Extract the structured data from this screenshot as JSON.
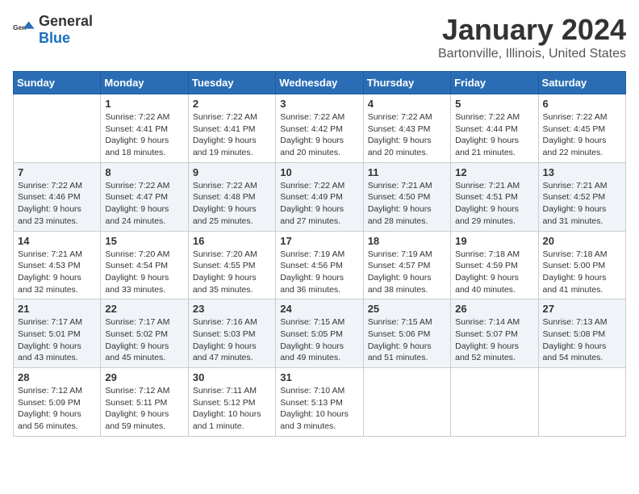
{
  "header": {
    "logo_general": "General",
    "logo_blue": "Blue",
    "month_title": "January 2024",
    "location": "Bartonville, Illinois, United States"
  },
  "days_of_week": [
    "Sunday",
    "Monday",
    "Tuesday",
    "Wednesday",
    "Thursday",
    "Friday",
    "Saturday"
  ],
  "weeks": [
    [
      {
        "day": "",
        "sunrise": "",
        "sunset": "",
        "daylight": ""
      },
      {
        "day": "1",
        "sunrise": "Sunrise: 7:22 AM",
        "sunset": "Sunset: 4:41 PM",
        "daylight": "Daylight: 9 hours and 18 minutes."
      },
      {
        "day": "2",
        "sunrise": "Sunrise: 7:22 AM",
        "sunset": "Sunset: 4:41 PM",
        "daylight": "Daylight: 9 hours and 19 minutes."
      },
      {
        "day": "3",
        "sunrise": "Sunrise: 7:22 AM",
        "sunset": "Sunset: 4:42 PM",
        "daylight": "Daylight: 9 hours and 20 minutes."
      },
      {
        "day": "4",
        "sunrise": "Sunrise: 7:22 AM",
        "sunset": "Sunset: 4:43 PM",
        "daylight": "Daylight: 9 hours and 20 minutes."
      },
      {
        "day": "5",
        "sunrise": "Sunrise: 7:22 AM",
        "sunset": "Sunset: 4:44 PM",
        "daylight": "Daylight: 9 hours and 21 minutes."
      },
      {
        "day": "6",
        "sunrise": "Sunrise: 7:22 AM",
        "sunset": "Sunset: 4:45 PM",
        "daylight": "Daylight: 9 hours and 22 minutes."
      }
    ],
    [
      {
        "day": "7",
        "sunrise": "Sunrise: 7:22 AM",
        "sunset": "Sunset: 4:46 PM",
        "daylight": "Daylight: 9 hours and 23 minutes."
      },
      {
        "day": "8",
        "sunrise": "Sunrise: 7:22 AM",
        "sunset": "Sunset: 4:47 PM",
        "daylight": "Daylight: 9 hours and 24 minutes."
      },
      {
        "day": "9",
        "sunrise": "Sunrise: 7:22 AM",
        "sunset": "Sunset: 4:48 PM",
        "daylight": "Daylight: 9 hours and 25 minutes."
      },
      {
        "day": "10",
        "sunrise": "Sunrise: 7:22 AM",
        "sunset": "Sunset: 4:49 PM",
        "daylight": "Daylight: 9 hours and 27 minutes."
      },
      {
        "day": "11",
        "sunrise": "Sunrise: 7:21 AM",
        "sunset": "Sunset: 4:50 PM",
        "daylight": "Daylight: 9 hours and 28 minutes."
      },
      {
        "day": "12",
        "sunrise": "Sunrise: 7:21 AM",
        "sunset": "Sunset: 4:51 PM",
        "daylight": "Daylight: 9 hours and 29 minutes."
      },
      {
        "day": "13",
        "sunrise": "Sunrise: 7:21 AM",
        "sunset": "Sunset: 4:52 PM",
        "daylight": "Daylight: 9 hours and 31 minutes."
      }
    ],
    [
      {
        "day": "14",
        "sunrise": "Sunrise: 7:21 AM",
        "sunset": "Sunset: 4:53 PM",
        "daylight": "Daylight: 9 hours and 32 minutes."
      },
      {
        "day": "15",
        "sunrise": "Sunrise: 7:20 AM",
        "sunset": "Sunset: 4:54 PM",
        "daylight": "Daylight: 9 hours and 33 minutes."
      },
      {
        "day": "16",
        "sunrise": "Sunrise: 7:20 AM",
        "sunset": "Sunset: 4:55 PM",
        "daylight": "Daylight: 9 hours and 35 minutes."
      },
      {
        "day": "17",
        "sunrise": "Sunrise: 7:19 AM",
        "sunset": "Sunset: 4:56 PM",
        "daylight": "Daylight: 9 hours and 36 minutes."
      },
      {
        "day": "18",
        "sunrise": "Sunrise: 7:19 AM",
        "sunset": "Sunset: 4:57 PM",
        "daylight": "Daylight: 9 hours and 38 minutes."
      },
      {
        "day": "19",
        "sunrise": "Sunrise: 7:18 AM",
        "sunset": "Sunset: 4:59 PM",
        "daylight": "Daylight: 9 hours and 40 minutes."
      },
      {
        "day": "20",
        "sunrise": "Sunrise: 7:18 AM",
        "sunset": "Sunset: 5:00 PM",
        "daylight": "Daylight: 9 hours and 41 minutes."
      }
    ],
    [
      {
        "day": "21",
        "sunrise": "Sunrise: 7:17 AM",
        "sunset": "Sunset: 5:01 PM",
        "daylight": "Daylight: 9 hours and 43 minutes."
      },
      {
        "day": "22",
        "sunrise": "Sunrise: 7:17 AM",
        "sunset": "Sunset: 5:02 PM",
        "daylight": "Daylight: 9 hours and 45 minutes."
      },
      {
        "day": "23",
        "sunrise": "Sunrise: 7:16 AM",
        "sunset": "Sunset: 5:03 PM",
        "daylight": "Daylight: 9 hours and 47 minutes."
      },
      {
        "day": "24",
        "sunrise": "Sunrise: 7:15 AM",
        "sunset": "Sunset: 5:05 PM",
        "daylight": "Daylight: 9 hours and 49 minutes."
      },
      {
        "day": "25",
        "sunrise": "Sunrise: 7:15 AM",
        "sunset": "Sunset: 5:06 PM",
        "daylight": "Daylight: 9 hours and 51 minutes."
      },
      {
        "day": "26",
        "sunrise": "Sunrise: 7:14 AM",
        "sunset": "Sunset: 5:07 PM",
        "daylight": "Daylight: 9 hours and 52 minutes."
      },
      {
        "day": "27",
        "sunrise": "Sunrise: 7:13 AM",
        "sunset": "Sunset: 5:08 PM",
        "daylight": "Daylight: 9 hours and 54 minutes."
      }
    ],
    [
      {
        "day": "28",
        "sunrise": "Sunrise: 7:12 AM",
        "sunset": "Sunset: 5:09 PM",
        "daylight": "Daylight: 9 hours and 56 minutes."
      },
      {
        "day": "29",
        "sunrise": "Sunrise: 7:12 AM",
        "sunset": "Sunset: 5:11 PM",
        "daylight": "Daylight: 9 hours and 59 minutes."
      },
      {
        "day": "30",
        "sunrise": "Sunrise: 7:11 AM",
        "sunset": "Sunset: 5:12 PM",
        "daylight": "Daylight: 10 hours and 1 minute."
      },
      {
        "day": "31",
        "sunrise": "Sunrise: 7:10 AM",
        "sunset": "Sunset: 5:13 PM",
        "daylight": "Daylight: 10 hours and 3 minutes."
      },
      {
        "day": "",
        "sunrise": "",
        "sunset": "",
        "daylight": ""
      },
      {
        "day": "",
        "sunrise": "",
        "sunset": "",
        "daylight": ""
      },
      {
        "day": "",
        "sunrise": "",
        "sunset": "",
        "daylight": ""
      }
    ]
  ]
}
